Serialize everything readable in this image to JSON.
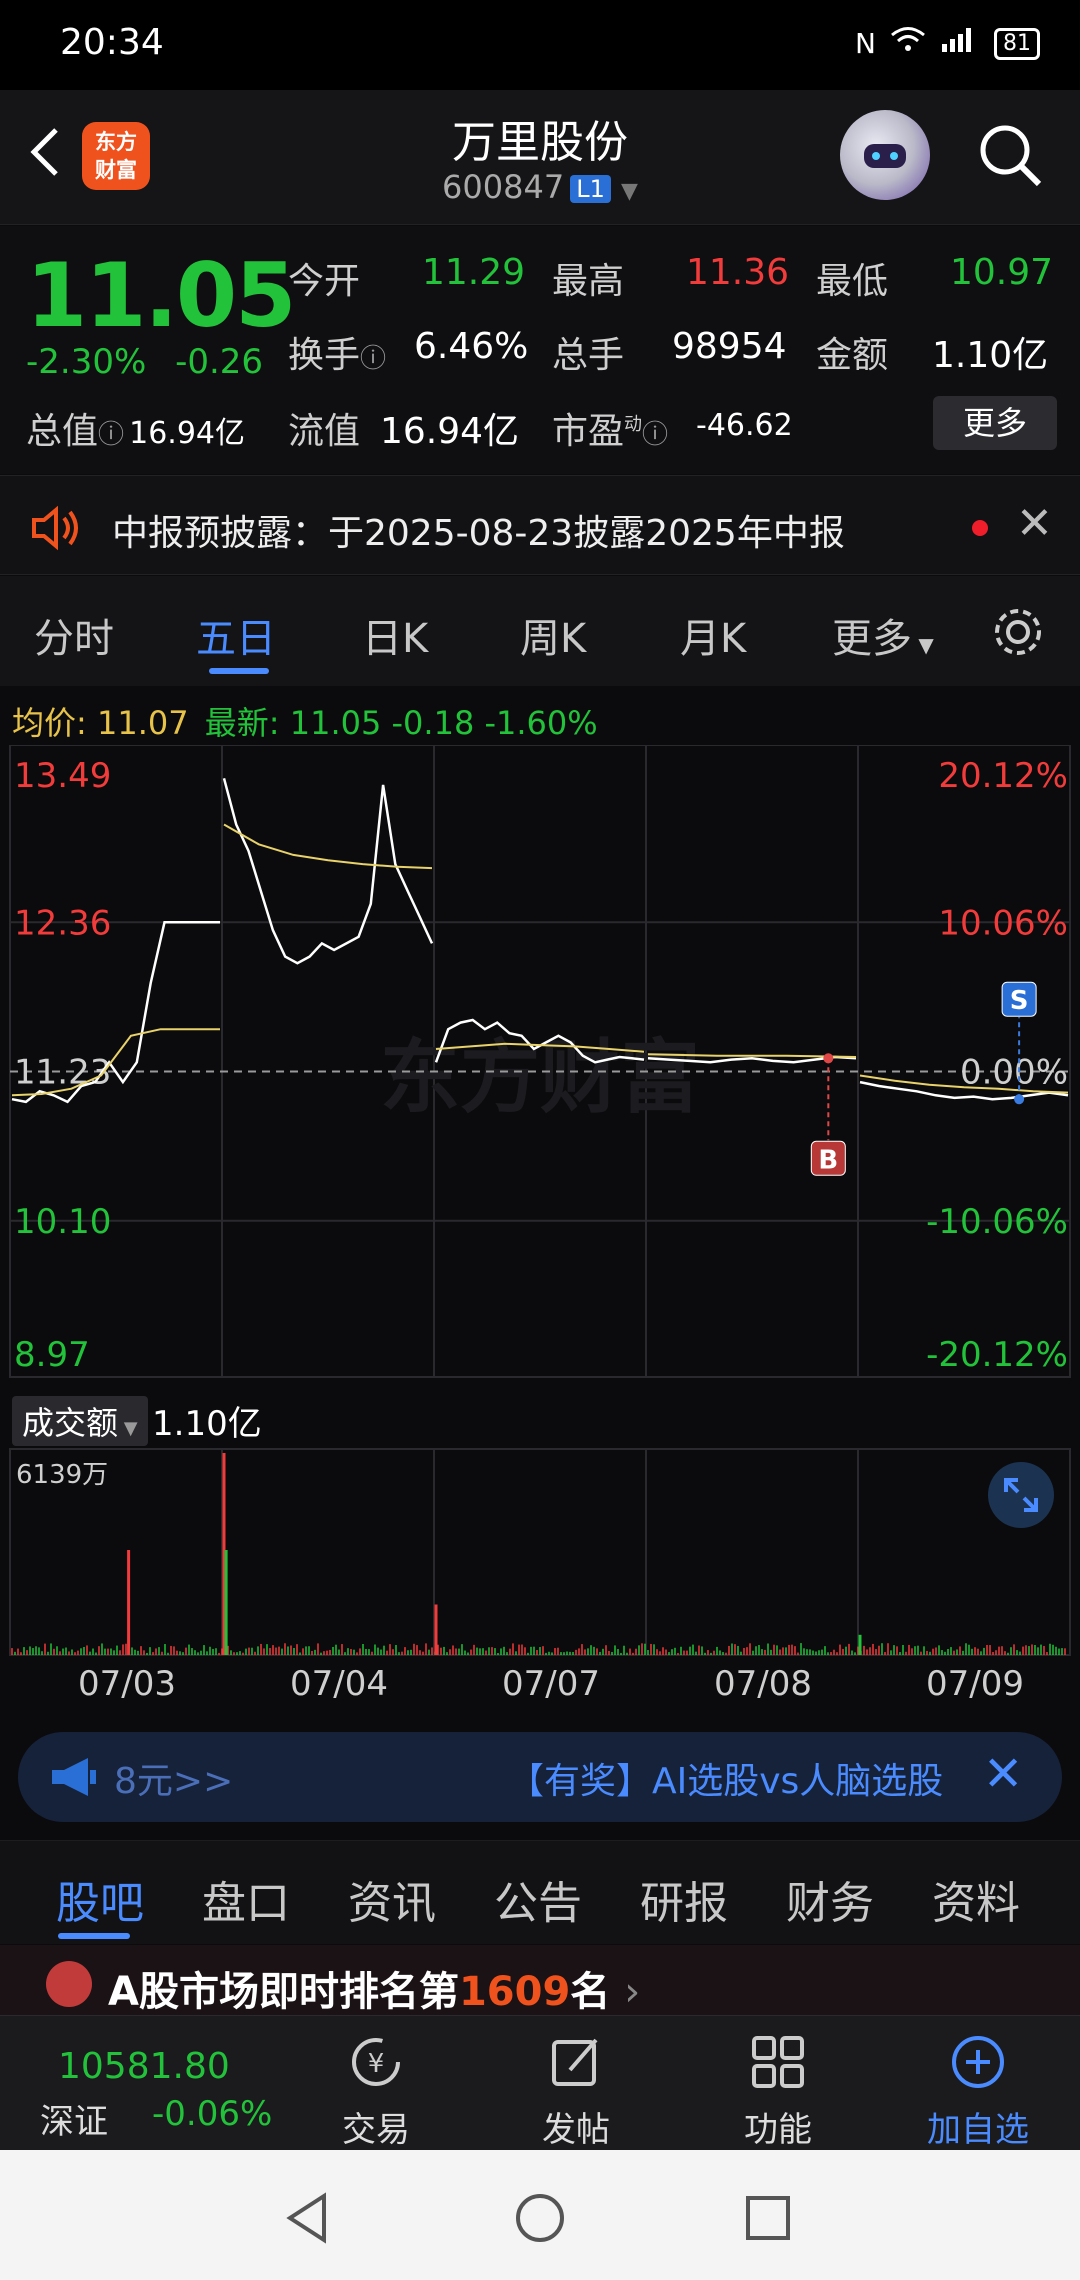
{
  "status_bar": {
    "time": "20:34",
    "battery": "81",
    "network": "4G"
  },
  "header": {
    "logo_text_line1": "东方",
    "logo_text_line2": "财富",
    "stock_name": "万里股份",
    "stock_code": "600847",
    "level_badge": "L1"
  },
  "quote": {
    "price": "11.05",
    "change_pct": "-2.30%",
    "change_abs": "-0.26",
    "open_label": "今开",
    "open_value": "11.29",
    "high_label": "最高",
    "high_value": "11.36",
    "low_label": "最低",
    "low_value": "10.97",
    "turnover_label": "换手",
    "turnover_value": "6.46%",
    "volume_label": "总手",
    "volume_value": "98954",
    "amount_label": "金额",
    "amount_value": "1.10亿",
    "mktcap_label": "总值",
    "mktcap_value": "16.94亿",
    "float_label": "流值",
    "float_value": "16.94亿",
    "pe_label": "市盈",
    "pe_sup": "动",
    "pe_value": "-46.62",
    "more_button": "更多"
  },
  "notice": {
    "text": "中报预披露：于2025-08-23披露2025年中报"
  },
  "period_tabs": [
    "分时",
    "五日",
    "日K",
    "周K",
    "月K",
    "更多"
  ],
  "active_period": "五日",
  "chart_header": {
    "avg_label": "均价:",
    "avg_value": "11.07",
    "latest_label": "最新:",
    "latest_value": "11.05",
    "latest_chg": "-0.18",
    "latest_pct": "-1.60%"
  },
  "chart_data": {
    "type": "line",
    "days": [
      "07/03",
      "07/04",
      "07/07",
      "07/08",
      "07/09"
    ],
    "y_ticks_left": [
      "13.49",
      "12.36",
      "11.23",
      "10.10",
      "8.97"
    ],
    "y_ticks_right": [
      "20.12%",
      "10.06%",
      "0.00%",
      "-10.06%",
      "-20.12%"
    ],
    "ylim": [
      8.97,
      13.49
    ],
    "prev_close": 11.23,
    "series": [
      {
        "name": "price",
        "color": "#ffffff",
        "segments": [
          [
            11.02,
            11.0,
            11.08,
            11.05,
            11.0,
            11.12,
            11.15,
            11.3,
            11.15,
            11.3,
            11.9,
            12.36,
            12.36,
            12.36,
            12.36,
            12.36
          ],
          [
            13.45,
            13.1,
            12.9,
            12.6,
            12.3,
            12.1,
            12.05,
            12.1,
            12.2,
            12.15,
            12.2,
            12.25,
            12.5,
            13.4,
            12.8,
            12.6,
            12.4,
            12.2
          ],
          [
            11.3,
            11.55,
            11.6,
            11.62,
            11.55,
            11.6,
            11.52,
            11.5,
            11.4,
            11.45,
            11.5,
            11.45,
            11.35,
            11.3,
            11.32,
            11.34,
            11.33,
            11.32
          ],
          [
            11.33,
            11.32,
            11.31,
            11.3,
            11.32,
            11.33,
            11.31,
            11.3,
            11.32,
            11.34,
            11.33
          ],
          [
            11.15,
            11.12,
            11.1,
            11.08,
            11.05,
            11.03,
            11.04,
            11.02,
            11.03,
            11.05,
            11.07,
            11.05
          ]
        ]
      },
      {
        "name": "avg",
        "color": "#e8d26a",
        "segments": [
          [
            11.05,
            11.06,
            11.1,
            11.2,
            11.5,
            11.55,
            11.55,
            11.55
          ],
          [
            13.1,
            12.95,
            12.87,
            12.83,
            12.8,
            12.78,
            12.77
          ],
          [
            11.4,
            11.42,
            11.44,
            11.43,
            11.42,
            11.4,
            11.38
          ],
          [
            11.36,
            11.35,
            11.35,
            11.34
          ],
          [
            11.2,
            11.16,
            11.13,
            11.11,
            11.1,
            11.08,
            11.07
          ]
        ]
      }
    ],
    "markers": [
      {
        "label": "B",
        "day": "07/08",
        "value": 11.33
      },
      {
        "label": "S",
        "day": "07/09",
        "value": 11.02
      }
    ],
    "grid": true,
    "watermark": "东方财富"
  },
  "volume": {
    "selector_label": "成交额",
    "total_value": "1.10亿",
    "max_label": "6139万",
    "spikes": [
      {
        "day": "07/03",
        "pos": 0.55,
        "h": 0.52,
        "color": "#f23b3b"
      },
      {
        "day": "07/04",
        "pos": 0.0,
        "h": 1.0,
        "color": "#f23b3b"
      },
      {
        "day": "07/04",
        "pos": 0.01,
        "h": 0.52,
        "color": "#22c33a"
      },
      {
        "day": "07/07",
        "pos": 0.0,
        "h": 0.25,
        "color": "#f23b3b"
      },
      {
        "day": "07/09",
        "pos": 0.0,
        "h": 0.1,
        "color": "#22c33a"
      }
    ]
  },
  "ad": {
    "left_text": "8元>>",
    "right_text": "【有奖】AI选股vs人脑选股"
  },
  "info_tabs": [
    "股吧",
    "盘口",
    "资讯",
    "公告",
    "研报",
    "财务",
    "资料"
  ],
  "active_info_tab": "股吧",
  "rank_bar": {
    "text_prefix": "A股市场即时排名第",
    "rank": "1609",
    "text_suffix": "名"
  },
  "bottom_nav": {
    "index_value": "10581.80",
    "index_name": "深证",
    "index_change": "-0.06%",
    "items": [
      "交易",
      "发帖",
      "功能",
      "加自选"
    ]
  },
  "colors": {
    "up": "#f23b3b",
    "down": "#22c33a",
    "accent": "#4a8bff",
    "avg": "#e8d26a"
  }
}
